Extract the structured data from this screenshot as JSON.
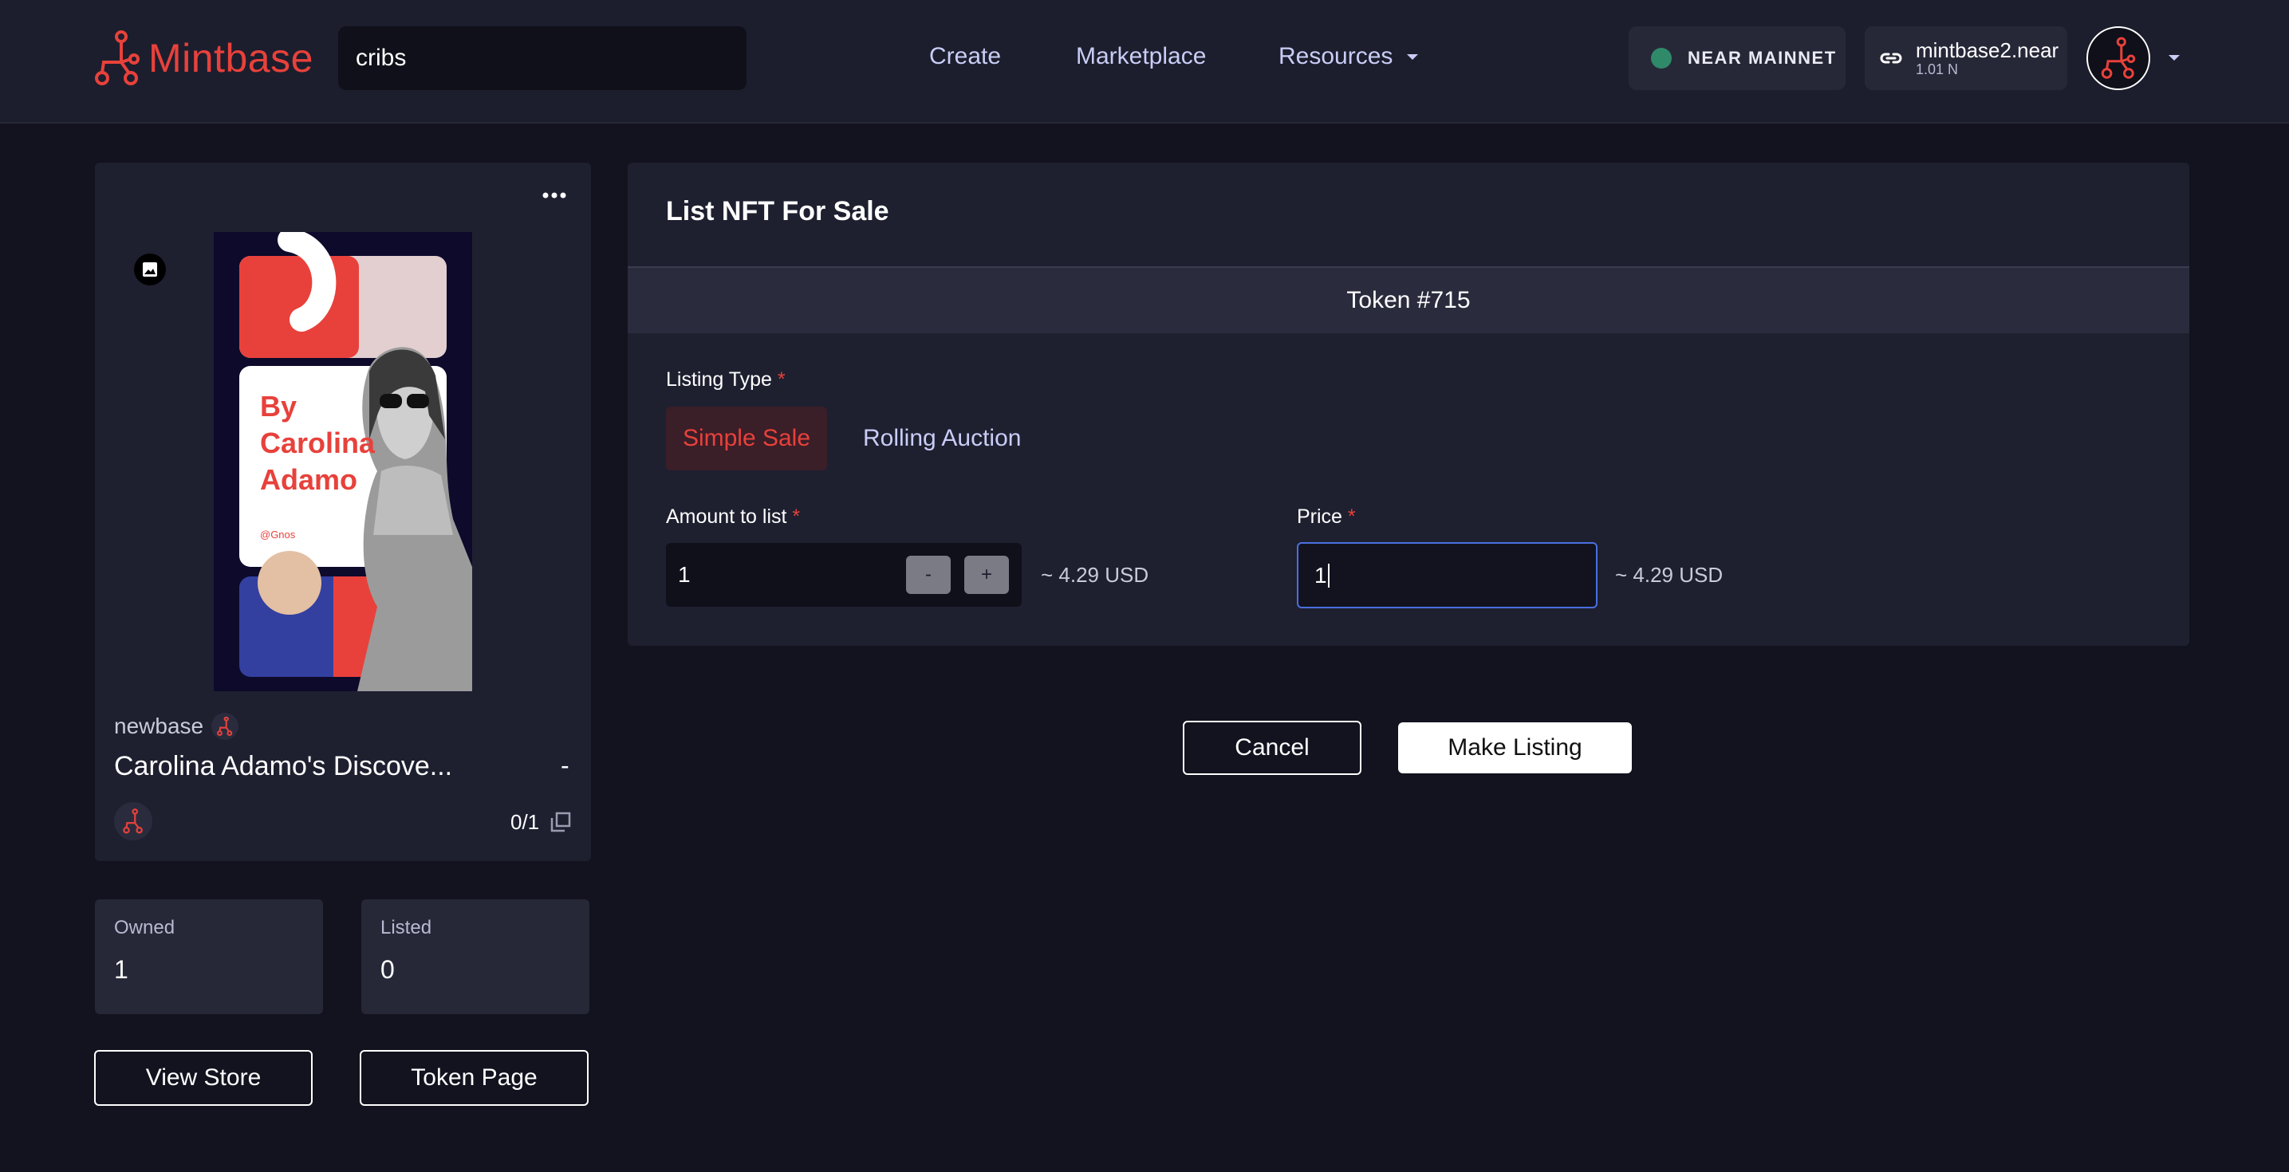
{
  "header": {
    "brand": "Mintbase",
    "search_value": "cribs",
    "nav": [
      {
        "label": "Create"
      },
      {
        "label": "Marketplace"
      },
      {
        "label": "Resources"
      }
    ],
    "network": "NEAR MAINNET",
    "account": {
      "name": "mintbase2.near",
      "balance": "1.01 N"
    }
  },
  "nft_card": {
    "artwork": {
      "title_lines": [
        "By",
        "Carolina",
        "Adamo"
      ],
      "handle": "@Gnos"
    },
    "store": "newbase",
    "title": "Carolina Adamo's Discove...",
    "price_dash": "-",
    "edition": "0/1"
  },
  "stats": [
    {
      "label": "Owned",
      "value": "1"
    },
    {
      "label": "Listed",
      "value": "0"
    }
  ],
  "left_buttons": {
    "view_store": "View Store",
    "token_page": "Token Page"
  },
  "listing": {
    "title": "List NFT For Sale",
    "token": "Token #715",
    "listing_type_label": "Listing Type",
    "required_mark": "*",
    "types": [
      "Simple Sale",
      "Rolling Auction"
    ],
    "amount_label": "Amount to list",
    "amount_value": "1",
    "minus": "-",
    "plus": "+",
    "amount_usd": "~ 4.29 USD",
    "price_label": "Price",
    "price_value": "1",
    "price_usd": "~ 4.29 USD"
  },
  "actions": {
    "cancel": "Cancel",
    "submit": "Make Listing"
  },
  "colors": {
    "accent": "#e8413b",
    "background": "#12131f",
    "panel": "#1e2030",
    "focus": "#4a6fe0",
    "network_dot": "#2f8a6a"
  }
}
